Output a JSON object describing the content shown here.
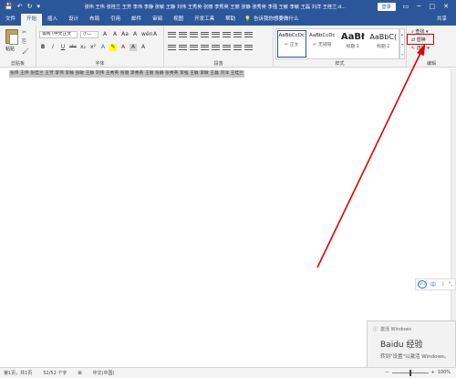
{
  "titlebar": {
    "quick_access": [
      "💾",
      "↶",
      "↻",
      "▾"
    ],
    "doc_title": "张伟 王伟 张桂兰 王芳 李伟 李静 张敏 王静 刘伟 王秀英 张丽 李秀英 王丽 张静 张秀英 李强 王敏 李敏 王磊 刘洋 王桂兰.d...",
    "login": "登录",
    "window_controls": [
      "▭",
      "─",
      "□",
      "✕"
    ]
  },
  "tabs": {
    "items": [
      "文件",
      "开始",
      "插入",
      "设计",
      "布局",
      "引用",
      "邮件",
      "审阅",
      "视图",
      "开发工具",
      "帮助"
    ],
    "active": "开始",
    "tell_me": "告诉我你想要做什么",
    "right": [
      "共享"
    ]
  },
  "ribbon": {
    "clipboard": {
      "label": "剪贴板",
      "paste": "粘贴",
      "icons": [
        "✂",
        "⎘",
        "🖌"
      ]
    },
    "font": {
      "label": "字体",
      "font_name": "等线 (中文正文",
      "font_size": "小二",
      "row1_buttons": [
        "A",
        "A",
        "Aa",
        "A",
        "wén",
        "A"
      ],
      "row2_buttons": [
        "B",
        "I",
        "U",
        "abc",
        "x₂",
        "x²",
        "A",
        "✎",
        "A",
        "A",
        "A"
      ]
    },
    "paragraph": {
      "label": "段落"
    },
    "styles": {
      "label": "样式",
      "items": [
        {
          "sample": "AaBbCcDc",
          "name": "↵ 正文"
        },
        {
          "sample": "AaBbCcDc",
          "name": "↵ 无间隔"
        },
        {
          "sample": "AaBł",
          "name": "标题 1"
        },
        {
          "sample": "AaBbC(",
          "name": "标题 2"
        }
      ]
    },
    "editing": {
      "label": "编辑",
      "find": "查找",
      "replace": "替换",
      "select": "选择"
    }
  },
  "document": {
    "text": "张伟 王伟 张桂兰 王芳 李伟 李静 张敏 王静 刘伟 王秀英 张丽 李秀英 王丽 张静 张秀英 李强 王敏 李敏 王磊 刘洋 王桂兰"
  },
  "ime": {
    "badge": "iFU",
    "lang": "中",
    "moon": "☽",
    "punct": "°,"
  },
  "notification": {
    "title": "激活 Windows",
    "big": "Baidu 经验",
    "sub": "转到\"设置\"以激活 Windows。"
  },
  "status": {
    "page": "第1页，共1页",
    "words": "52/52 个字",
    "lang": "中文(中国)",
    "zoom": "100%"
  },
  "colors": {
    "brand": "#2b579a",
    "highlight_box": "#e00000",
    "selection": "#c9c9c9"
  }
}
